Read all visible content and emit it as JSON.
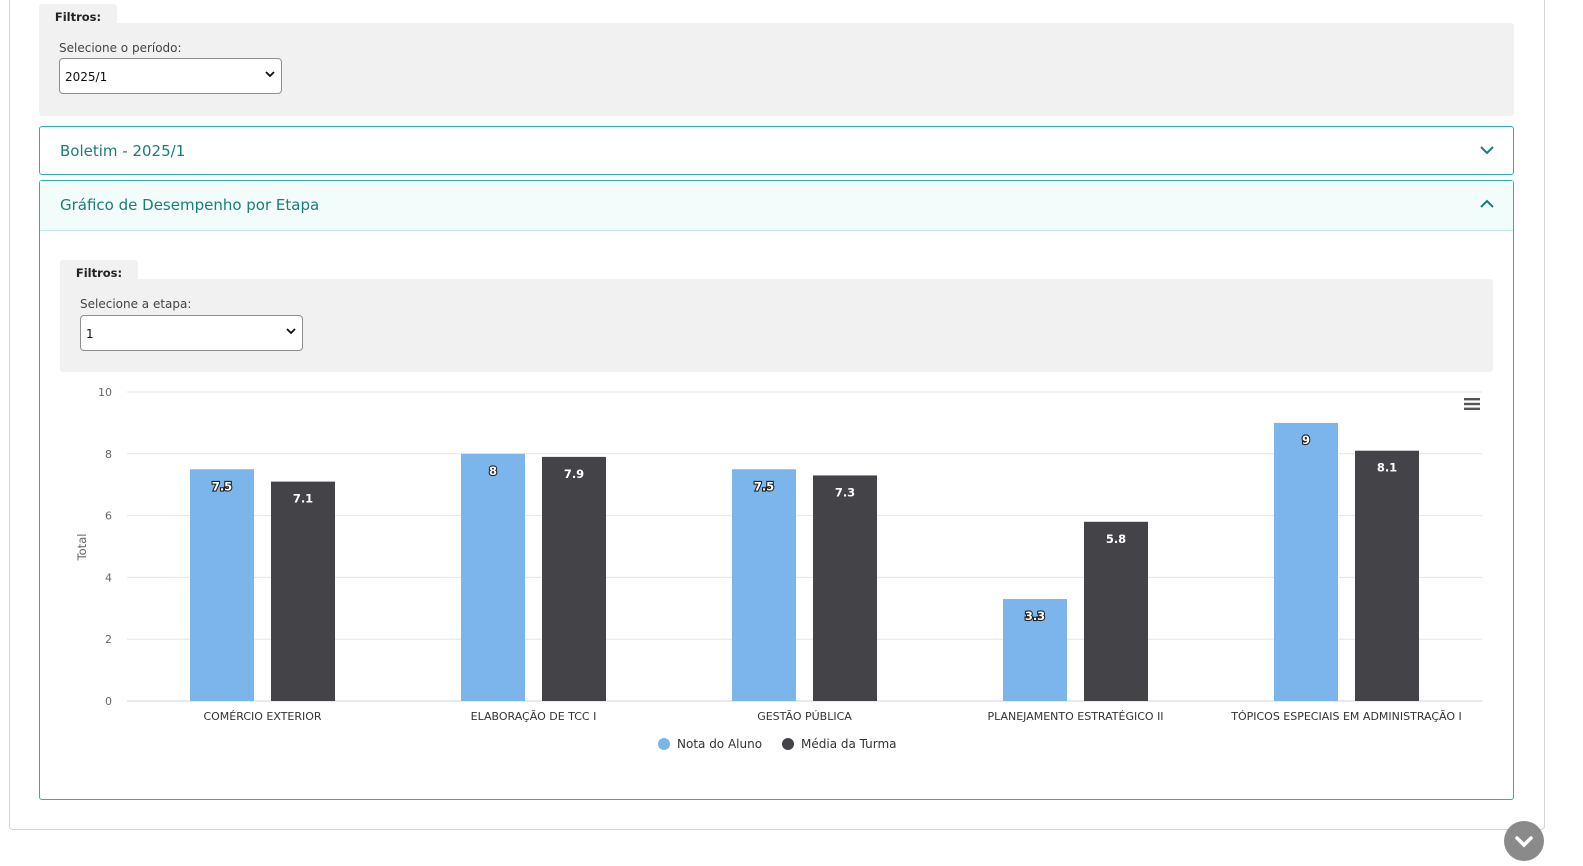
{
  "period_filter": {
    "tab_label": "Filtros:",
    "label": "Selecione o período:",
    "selected": "2025/1"
  },
  "boletim": {
    "title": "Boletim - 2025/1"
  },
  "desempenho": {
    "title": "Gráfico de Desempenho por Etapa",
    "filter": {
      "tab_label": "Filtros:",
      "label": "Selecione a etapa:",
      "selected": "1"
    }
  },
  "colors": {
    "accent": "#26b5ad",
    "accent_text": "#1b7d75",
    "aluno": "#7cb5ec",
    "turma": "#434348"
  },
  "icons": {
    "period_select": "chevron-down-icon",
    "boletim_toggle": "chevron-down-icon",
    "desempenho_toggle": "chevron-up-icon",
    "chart_menu": "hamburger-menu-icon",
    "scroll": "chevron-down-icon"
  },
  "chart_data": {
    "type": "bar",
    "categories": [
      "COMÉRCIO EXTERIOR",
      "ELABORAÇÃO DE TCC I",
      "GESTÃO PÚBLICA",
      "PLANEJAMENTO ESTRATÉGICO II",
      "TÓPICOS ESPECIAIS EM ADMINISTRAÇÃO I"
    ],
    "series": [
      {
        "name": "Nota do Aluno",
        "color": "#7cb5ec",
        "values": [
          7.5,
          8,
          7.5,
          3.3,
          9
        ]
      },
      {
        "name": "Média da Turma",
        "color": "#434348",
        "values": [
          7.1,
          7.9,
          7.3,
          5.8,
          8.1
        ]
      }
    ],
    "ylabel": "Total",
    "ylim": [
      0,
      10
    ],
    "yticks": [
      0,
      2,
      4,
      6,
      8,
      10
    ],
    "grid": true,
    "legend": "bottom-center",
    "data_labels": true
  }
}
